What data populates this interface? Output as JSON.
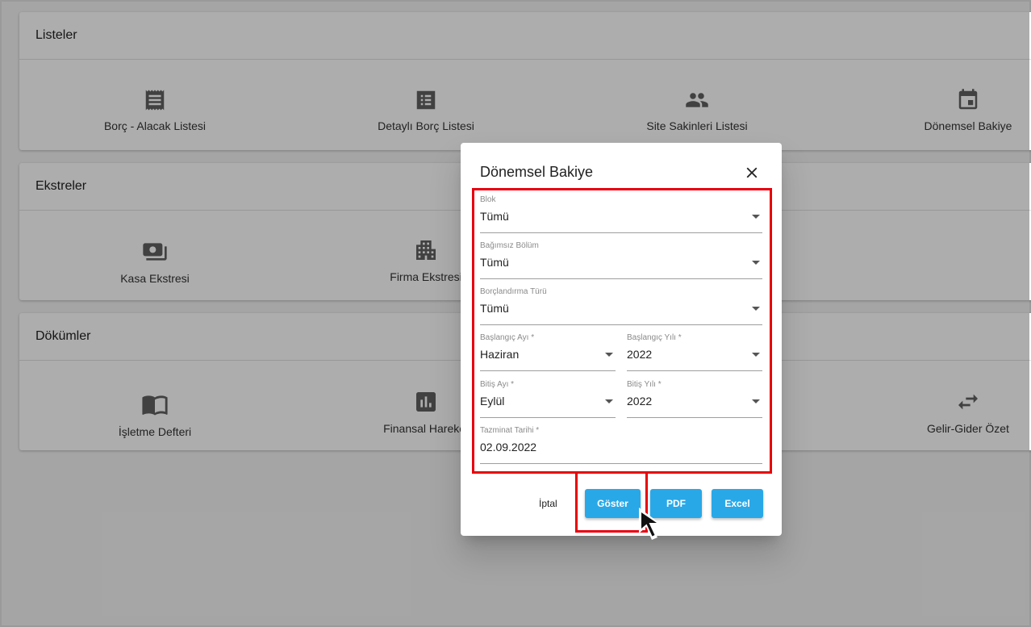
{
  "sections": {
    "listeler": {
      "title": "Listeler",
      "items": [
        "Borç - Alacak Listesi",
        "Detaylı Borç Listesi",
        "Site Sakinleri Listesi",
        "Dönemsel Bakiye"
      ]
    },
    "ekstreler": {
      "title": "Ekstreler",
      "items": [
        "Kasa Ekstresi",
        "Firma Ekstresi"
      ]
    },
    "dokumler": {
      "title": "Dökümler",
      "items": [
        "İşletme Defteri",
        "Finansal Hareket",
        "Gelir-Gider Özet"
      ]
    }
  },
  "dialog": {
    "title": "Dönemsel Bakiye",
    "fields": {
      "blok": {
        "label": "Blok",
        "value": "Tümü"
      },
      "bagimsiz": {
        "label": "Bağımsız Bölüm",
        "value": "Tümü"
      },
      "borclandirma": {
        "label": "Borçlandırma Türü",
        "value": "Tümü"
      },
      "baslangic_ay": {
        "label": "Başlangıç Ayı *",
        "value": "Haziran"
      },
      "baslangic_yil": {
        "label": "Başlangıç Yılı *",
        "value": "2022"
      },
      "bitis_ay": {
        "label": "Bitiş Ayı *",
        "value": "Eylül"
      },
      "bitis_yil": {
        "label": "Bitiş Yılı *",
        "value": "2022"
      },
      "tazminat": {
        "label": "Tazminat Tarihi *",
        "value": "02.09.2022"
      }
    },
    "buttons": {
      "cancel": "İptal",
      "show": "Göster",
      "pdf": "PDF",
      "excel": "Excel"
    }
  },
  "colors": {
    "accent": "#29a8e8",
    "highlight": "#e8000b"
  }
}
